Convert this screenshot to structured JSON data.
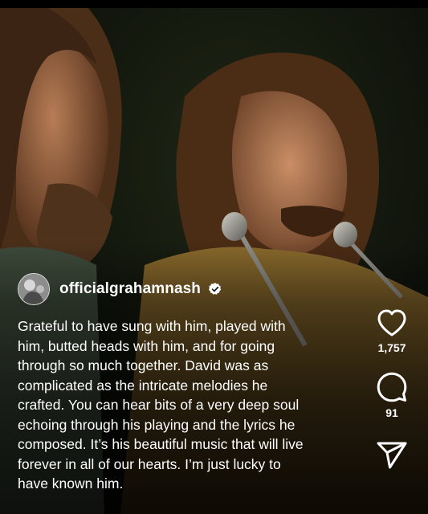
{
  "post": {
    "username": "officialgrahamnash",
    "verified": true,
    "caption_lines": [
      "Grateful to have sung with him, played with",
      "him, butted heads with him, and for going",
      "through so much together. David was as",
      "complicated as the  intricate melodies he",
      "crafted. You can hear bits of a very deep soul",
      "echoing through his playing and the lyrics he",
      "composed. It’s his beautiful music that will live",
      "forever in all of our hearts. I’m just lucky to",
      "have known him."
    ]
  },
  "actions": {
    "like_icon": "heart-icon",
    "like_count": "1,757",
    "comment_icon": "comment-icon",
    "comment_count": "91",
    "share_icon": "share-icon"
  }
}
